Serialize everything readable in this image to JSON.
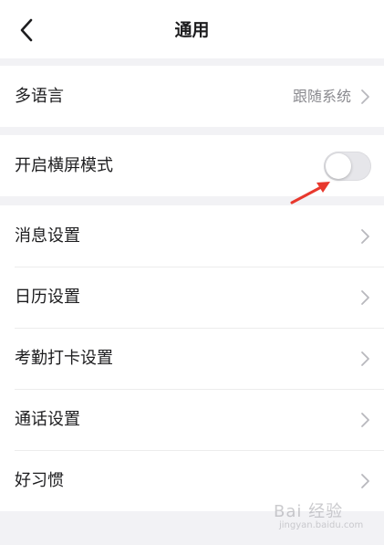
{
  "header": {
    "title": "通用"
  },
  "sections": {
    "language": {
      "label": "多语言",
      "value": "跟随系统"
    },
    "landscape": {
      "label": "开启横屏模式",
      "enabled": false
    },
    "settings": [
      {
        "label": "消息设置"
      },
      {
        "label": "日历设置"
      },
      {
        "label": "考勤打卡设置"
      },
      {
        "label": "通话设置"
      },
      {
        "label": "好习惯"
      }
    ]
  },
  "annotation_color": "#e8382d",
  "watermark": {
    "text": "Bai 经验",
    "sub": "jingyan.baidu.com"
  }
}
